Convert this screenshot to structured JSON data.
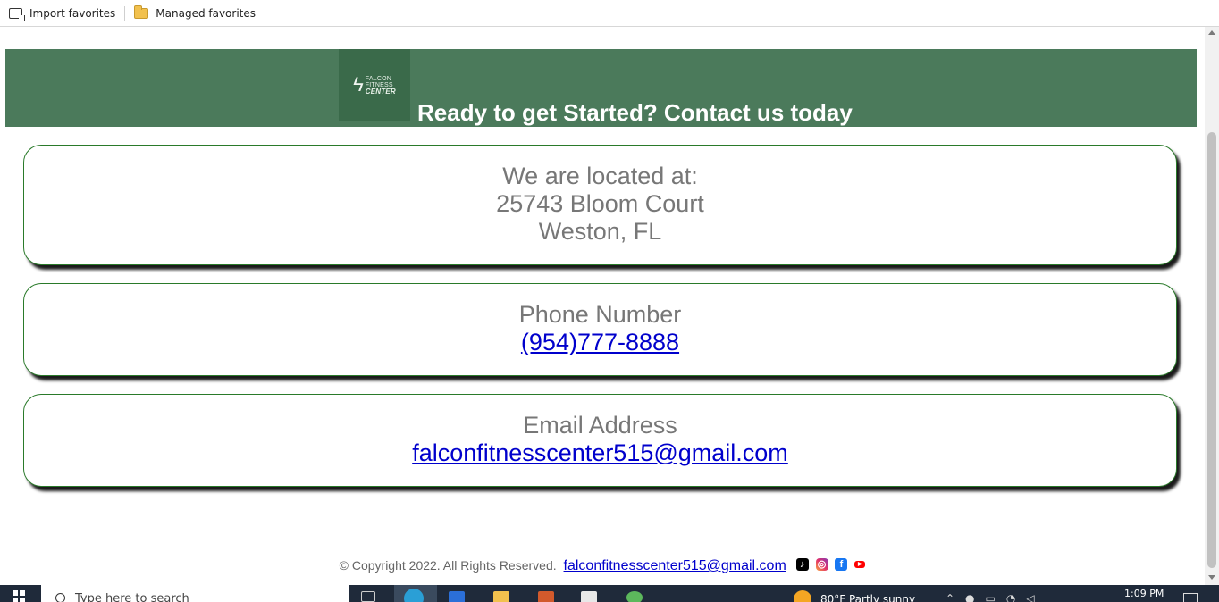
{
  "favorites_bar": {
    "items": [
      {
        "label": "Import favorites",
        "icon": "import-favorites-icon"
      },
      {
        "label": "Managed favorites",
        "icon": "folder-icon"
      }
    ]
  },
  "hero": {
    "logo": {
      "line1": "FALCON",
      "line2": "FITNESS",
      "line3": "CENTER"
    },
    "title": "Ready to get Started? Contact us today",
    "background": "#4b7a5b"
  },
  "location": {
    "heading": "We are located at:",
    "street": "25743 Bloom Court",
    "city": "Weston, FL"
  },
  "phone": {
    "heading": "Phone Number",
    "number": "(954)777-8888"
  },
  "email": {
    "heading": "Email Address",
    "address": "falconfitnesscenter515@gmail.com"
  },
  "footer": {
    "copyright": "© Copyright 2022. All Rights Reserved.",
    "email": "falconfitnesscenter515@gmail.com",
    "social_icons": [
      "tiktok-icon",
      "instagram-icon",
      "facebook-icon",
      "youtube-icon"
    ]
  },
  "taskbar": {
    "search_placeholder": "Type here to search",
    "weather": "80°F  Partly sunny",
    "time": "1:09 PM"
  },
  "colors": {
    "accent_green": "#4b7a5b",
    "card_border": "#2a7a2a",
    "link": "#0000cc",
    "muted_text": "#777777"
  }
}
